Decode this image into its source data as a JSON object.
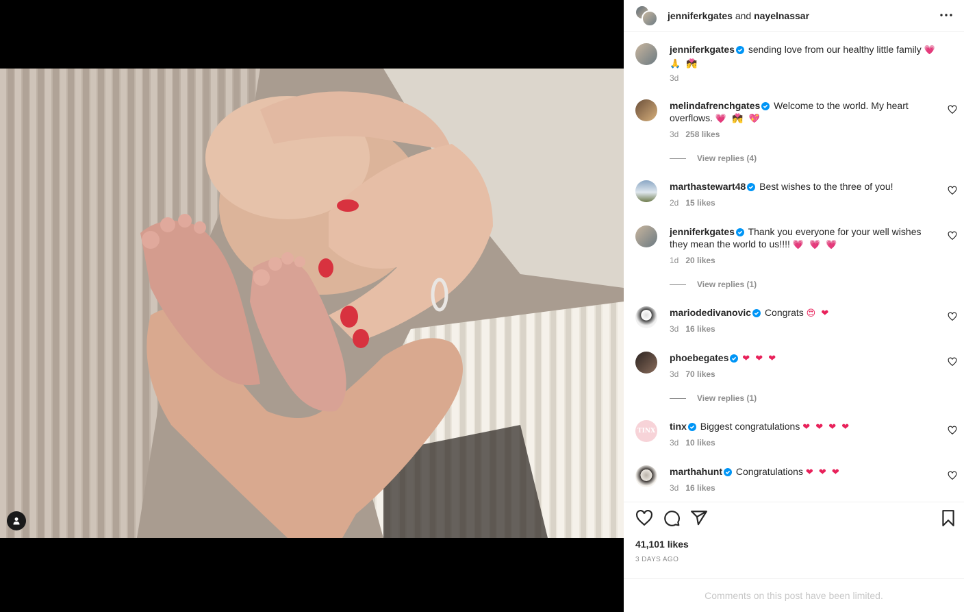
{
  "post": {
    "author": "jenniferkgates",
    "and_text": "and",
    "coauthor": "nayelnassar",
    "caption": {
      "username": "jenniferkgates",
      "text": "sending love from our healthy little family",
      "emoji": "💗 🙏 💏",
      "time": "3d"
    },
    "likes": "41,101 likes",
    "date": "3 DAYS AGO",
    "limited_notice": "Comments on this post have been limited."
  },
  "comments": [
    {
      "username": "melindafrenchgates",
      "text": "Welcome to the world. My heart overflows.",
      "emoji": "💗 💏 💖",
      "time": "3d",
      "likes": "258 likes",
      "replies": "View replies (4)"
    },
    {
      "username": "marthastewart48",
      "text": "Best wishes to the three of you!",
      "emoji": "",
      "time": "2d",
      "likes": "15 likes",
      "replies": ""
    },
    {
      "username": "jenniferkgates",
      "text": "Thank you everyone for your well wishes they mean the world to us!!!!",
      "emoji": "💗 💗 💗",
      "time": "1d",
      "likes": "20 likes",
      "replies": "View replies (1)"
    },
    {
      "username": "mariodedivanovic",
      "text": "Congrats",
      "emoji": "😍 ❤",
      "time": "3d",
      "likes": "16 likes",
      "replies": ""
    },
    {
      "username": "phoebegates",
      "text": "",
      "emoji": "❤ ❤ ❤",
      "time": "3d",
      "likes": "70 likes",
      "replies": "View replies (1)"
    },
    {
      "username": "tinx",
      "text": "Biggest congratulations",
      "emoji": "❤ ❤ ❤ ❤",
      "time": "3d",
      "likes": "10 likes",
      "replies": "",
      "avatar_text": "TINX"
    },
    {
      "username": "marthahunt",
      "text": "Congratulations",
      "emoji": "❤ ❤ ❤",
      "time": "3d",
      "likes": "16 likes",
      "replies": ""
    }
  ],
  "icons": {
    "more": "more-horizontal-icon",
    "verified": "verified-badge-icon",
    "like": "heart-icon",
    "comment": "comment-icon",
    "share": "share-icon",
    "save": "bookmark-icon",
    "tag": "user-tag-icon"
  },
  "colors": {
    "verified": "#0095f6",
    "text": "#262626",
    "muted": "#8e8e8e",
    "divider": "#efefef"
  }
}
